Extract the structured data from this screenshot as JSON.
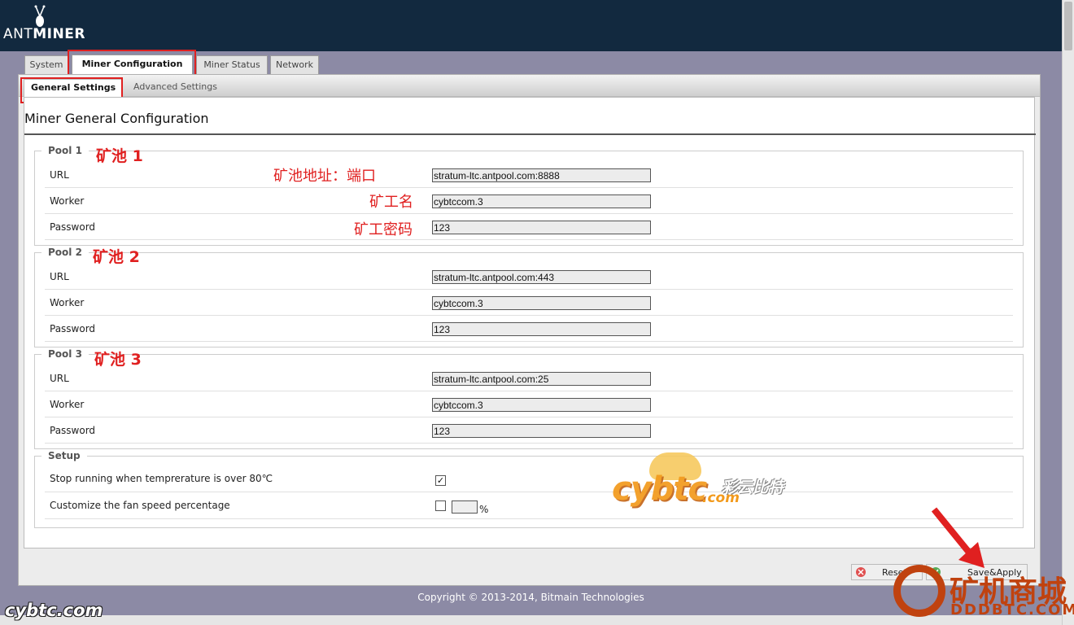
{
  "brand": {
    "logo_text_light": "ANT",
    "logo_text_bold": "MINER"
  },
  "tabs": [
    {
      "label": "System"
    },
    {
      "label": "Miner Configuration"
    },
    {
      "label": "Miner Status"
    },
    {
      "label": "Network"
    }
  ],
  "subtabs": [
    {
      "label": "General Settings"
    },
    {
      "label": "Advanced Settings"
    }
  ],
  "page_title": "Miner General Configuration",
  "pools": [
    {
      "legend": "Pool 1",
      "annotation": "矿池 1",
      "url_label": "URL",
      "url": "stratum-ltc.antpool.com:8888",
      "worker_label": "Worker",
      "worker": "cybtccom.3",
      "password_label": "Password",
      "password": "123"
    },
    {
      "legend": "Pool 2",
      "annotation": "矿池 2",
      "url_label": "URL",
      "url": "stratum-ltc.antpool.com:443",
      "worker_label": "Worker",
      "worker": "cybtccom.3",
      "password_label": "Password",
      "password": "123"
    },
    {
      "legend": "Pool 3",
      "annotation": "矿池 3",
      "url_label": "URL",
      "url": "stratum-ltc.antpool.com:25",
      "worker_label": "Worker",
      "worker": "cybtccom.3",
      "password_label": "Password",
      "password": "123"
    }
  ],
  "field_annotations": {
    "url": "矿池地址：端口",
    "worker": "矿工名",
    "password": "矿工密码"
  },
  "setup": {
    "legend": "Setup",
    "stop_label": "Stop running when temprerature is over 80℃",
    "stop_checked": true,
    "fan_label": "Customize the fan speed percentage",
    "fan_checked": false,
    "fan_value": "",
    "fan_unit": "%"
  },
  "buttons": {
    "reset": "Reset",
    "save": "Save&Apply"
  },
  "footer": "Copyright © 2013-2014, Bitmain Technologies",
  "watermarks": {
    "cybtc": "cybtc",
    "cybtc_com": ".com",
    "cybtc_cn": "彩云比特",
    "corner_left": "cybtc.com",
    "corner_right_cn": "矿机商城",
    "corner_right_en": "DDDBTC.COM"
  },
  "colors": {
    "header": "#12293f",
    "annotation_red": "#e02020",
    "page_bg": "#8c8aa5"
  },
  "icons": {
    "logo": "ant-logo-icon",
    "reset": "reset-icon",
    "save": "save-icon",
    "arrow": "red-arrow-icon"
  }
}
